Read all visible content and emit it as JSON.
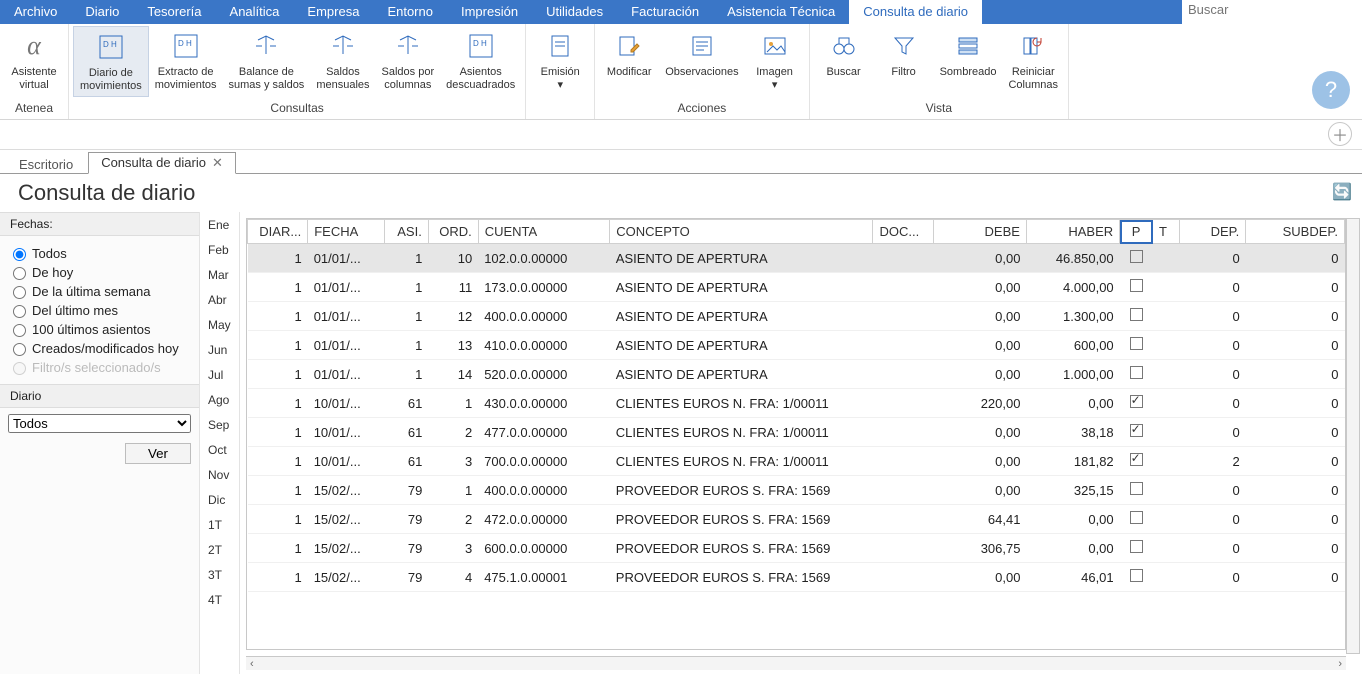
{
  "menubar": {
    "items": [
      {
        "label": "Archivo"
      },
      {
        "label": "Diario"
      },
      {
        "label": "Tesorería"
      },
      {
        "label": "Analítica"
      },
      {
        "label": "Empresa"
      },
      {
        "label": "Entorno"
      },
      {
        "label": "Impresión"
      },
      {
        "label": "Utilidades"
      },
      {
        "label": "Facturación"
      },
      {
        "label": "Asistencia Técnica"
      },
      {
        "label": "Consulta de diario",
        "active": true
      }
    ],
    "search_placeholder": "Buscar"
  },
  "ribbon": {
    "groups": [
      {
        "label": "Atenea",
        "items": [
          {
            "label": "Asistente\nvirtual",
            "icon": "alpha-icon"
          }
        ]
      },
      {
        "label": "Consultas",
        "items": [
          {
            "label": "Diario de\nmovimientos",
            "icon": "doc-dh-icon",
            "active": true
          },
          {
            "label": "Extracto de\nmovimientos",
            "icon": "doc-dh-icon"
          },
          {
            "label": "Balance de\nsumas y saldos",
            "icon": "scale-icon"
          },
          {
            "label": "Saldos\nmensuales",
            "icon": "scale-month-icon"
          },
          {
            "label": "Saldos por\ncolumnas",
            "icon": "scale-col-icon"
          },
          {
            "label": "Asientos\ndescuadrados",
            "icon": "doc-dh-icon"
          }
        ]
      },
      {
        "label": "",
        "items": [
          {
            "label": "Emisión\n▾",
            "icon": "doc-icon"
          }
        ]
      },
      {
        "label": "Acciones",
        "items": [
          {
            "label": "Modificar",
            "icon": "edit-icon"
          },
          {
            "label": "Observaciones",
            "icon": "note-icon"
          },
          {
            "label": "Imagen\n▾",
            "icon": "image-icon"
          }
        ]
      },
      {
        "label": "Vista",
        "items": [
          {
            "label": "Buscar",
            "icon": "binoculars-icon"
          },
          {
            "label": "Filtro",
            "icon": "funnel-icon"
          },
          {
            "label": "Sombreado",
            "icon": "rows-icon"
          },
          {
            "label": "Reiniciar\nColumnas",
            "icon": "reset-cols-icon"
          }
        ]
      }
    ]
  },
  "tabs": [
    {
      "label": "Escritorio",
      "active": false,
      "closable": false
    },
    {
      "label": "Consulta de diario",
      "active": true,
      "closable": true
    }
  ],
  "page_title": "Consulta de diario",
  "left_panel": {
    "fechas_label": "Fechas:",
    "radios": [
      {
        "label": "Todos",
        "checked": true
      },
      {
        "label": "De hoy"
      },
      {
        "label": "De la última semana"
      },
      {
        "label": "Del último mes"
      },
      {
        "label": "100 últimos asientos"
      },
      {
        "label": "Creados/modificados hoy"
      },
      {
        "label": "Filtro/s seleccionado/s",
        "disabled": true
      }
    ],
    "diario_label": "Diario",
    "diario_combo": "Todos",
    "ver_btn": "Ver"
  },
  "periods": [
    "Ene",
    "Feb",
    "Mar",
    "Abr",
    "May",
    "Jun",
    "Jul",
    "Ago",
    "Sep",
    "Oct",
    "Nov",
    "Dic",
    "1T",
    "2T",
    "3T",
    "4T"
  ],
  "grid": {
    "columns": [
      {
        "label": "DIAR...",
        "align": "right"
      },
      {
        "label": "FECHA",
        "align": "left"
      },
      {
        "label": "ASI.",
        "align": "right"
      },
      {
        "label": "ORD.",
        "align": "right"
      },
      {
        "label": "CUENTA",
        "align": "left"
      },
      {
        "label": "CONCEPTO",
        "align": "left"
      },
      {
        "label": "DOC...",
        "align": "left"
      },
      {
        "label": "DEBE",
        "align": "right"
      },
      {
        "label": "HABER",
        "align": "right"
      },
      {
        "label": "P",
        "align": "center",
        "highlight": true
      },
      {
        "label": "T",
        "align": "left"
      },
      {
        "label": "DEP.",
        "align": "right"
      },
      {
        "label": "SUBDEP.",
        "align": "right"
      }
    ],
    "rows": [
      {
        "selected": true,
        "diar": "1",
        "fecha": "01/01/...",
        "asi": "1",
        "ord": "10",
        "cuenta": "102.0.0.00000",
        "concepto": "ASIENTO DE APERTURA",
        "doc": "",
        "debe": "0,00",
        "haber": "46.850,00",
        "p": false,
        "t": "",
        "dep": "0",
        "subdep": "0"
      },
      {
        "diar": "1",
        "fecha": "01/01/...",
        "asi": "1",
        "ord": "11",
        "cuenta": "173.0.0.00000",
        "concepto": "ASIENTO DE APERTURA",
        "doc": "",
        "debe": "0,00",
        "haber": "4.000,00",
        "p": false,
        "t": "",
        "dep": "0",
        "subdep": "0"
      },
      {
        "diar": "1",
        "fecha": "01/01/...",
        "asi": "1",
        "ord": "12",
        "cuenta": "400.0.0.00000",
        "concepto": "ASIENTO DE APERTURA",
        "doc": "",
        "debe": "0,00",
        "haber": "1.300,00",
        "p": false,
        "t": "",
        "dep": "0",
        "subdep": "0"
      },
      {
        "diar": "1",
        "fecha": "01/01/...",
        "asi": "1",
        "ord": "13",
        "cuenta": "410.0.0.00000",
        "concepto": "ASIENTO DE APERTURA",
        "doc": "",
        "debe": "0,00",
        "haber": "600,00",
        "p": false,
        "t": "",
        "dep": "0",
        "subdep": "0"
      },
      {
        "diar": "1",
        "fecha": "01/01/...",
        "asi": "1",
        "ord": "14",
        "cuenta": "520.0.0.00000",
        "concepto": "ASIENTO DE APERTURA",
        "doc": "",
        "debe": "0,00",
        "haber": "1.000,00",
        "p": false,
        "t": "",
        "dep": "0",
        "subdep": "0"
      },
      {
        "diar": "1",
        "fecha": "10/01/...",
        "asi": "61",
        "ord": "1",
        "cuenta": "430.0.0.00000",
        "concepto": "CLIENTES EUROS N. FRA:  1/00011",
        "doc": "",
        "debe": "220,00",
        "haber": "0,00",
        "p": true,
        "t": "",
        "dep": "0",
        "subdep": "0"
      },
      {
        "diar": "1",
        "fecha": "10/01/...",
        "asi": "61",
        "ord": "2",
        "cuenta": "477.0.0.00000",
        "concepto": "CLIENTES EUROS N. FRA:  1/00011",
        "doc": "",
        "debe": "0,00",
        "haber": "38,18",
        "p": true,
        "t": "",
        "dep": "0",
        "subdep": "0"
      },
      {
        "diar": "1",
        "fecha": "10/01/...",
        "asi": "61",
        "ord": "3",
        "cuenta": "700.0.0.00000",
        "concepto": "CLIENTES EUROS N. FRA:  1/00011",
        "doc": "",
        "debe": "0,00",
        "haber": "181,82",
        "p": true,
        "t": "",
        "dep": "2",
        "subdep": "0"
      },
      {
        "diar": "1",
        "fecha": "15/02/...",
        "asi": "79",
        "ord": "1",
        "cuenta": "400.0.0.00000",
        "concepto": "PROVEEDOR EUROS S. FRA:  1569",
        "doc": "",
        "debe": "0,00",
        "haber": "325,15",
        "p": false,
        "t": "",
        "dep": "0",
        "subdep": "0"
      },
      {
        "diar": "1",
        "fecha": "15/02/...",
        "asi": "79",
        "ord": "2",
        "cuenta": "472.0.0.00000",
        "concepto": "PROVEEDOR EUROS S. FRA:  1569",
        "doc": "",
        "debe": "64,41",
        "haber": "0,00",
        "p": false,
        "t": "",
        "dep": "0",
        "subdep": "0"
      },
      {
        "diar": "1",
        "fecha": "15/02/...",
        "asi": "79",
        "ord": "3",
        "cuenta": "600.0.0.00000",
        "concepto": "PROVEEDOR EUROS S. FRA:  1569",
        "doc": "",
        "debe": "306,75",
        "haber": "0,00",
        "p": false,
        "t": "",
        "dep": "0",
        "subdep": "0"
      },
      {
        "diar": "1",
        "fecha": "15/02/...",
        "asi": "79",
        "ord": "4",
        "cuenta": "475.1.0.00001",
        "concepto": "PROVEEDOR EUROS S. FRA:  1569",
        "doc": "",
        "debe": "0,00",
        "haber": "46,01",
        "p": false,
        "t": "",
        "dep": "0",
        "subdep": "0"
      }
    ]
  }
}
